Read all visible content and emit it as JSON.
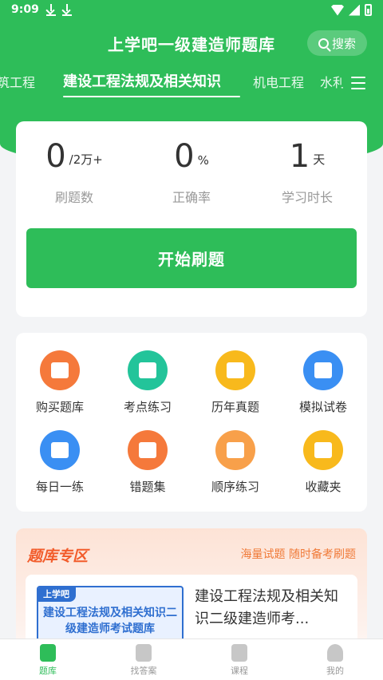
{
  "status_bar": {
    "time": "9:09"
  },
  "header": {
    "title": "上学吧一级建造师题库",
    "search_label": "搜索"
  },
  "tabs": [
    {
      "label": "筑工程"
    },
    {
      "label": "建设工程法规及相关知识"
    },
    {
      "label": "机电工程"
    },
    {
      "label": "水利"
    }
  ],
  "stats": [
    {
      "value": "0",
      "unit": "/2万+",
      "label": "刷题数"
    },
    {
      "value": "0",
      "unit": "%",
      "label": "正确率"
    },
    {
      "value": "1",
      "unit": "天",
      "label": "学习时长"
    }
  ],
  "start_button": "开始刷题",
  "features": [
    {
      "label": "购买题库",
      "icon": "cart-icon",
      "color": "#f5793b"
    },
    {
      "label": "考点练习",
      "icon": "star-board-icon",
      "color": "#23c49a"
    },
    {
      "label": "历年真题",
      "icon": "calendar-doc-icon",
      "color": "#f8b91c"
    },
    {
      "label": "模拟试卷",
      "icon": "chart-board-icon",
      "color": "#3a8ff3"
    },
    {
      "label": "每日一练",
      "icon": "calendar-check-icon",
      "color": "#3a8ff3"
    },
    {
      "label": "错题集",
      "icon": "wrong-doc-icon",
      "color": "#f5793b"
    },
    {
      "label": "顺序练习",
      "icon": "edit-doc-icon",
      "color": "#f8a04a"
    },
    {
      "label": "收藏夹",
      "icon": "star-icon",
      "color": "#f8b91c"
    }
  ],
  "zone": {
    "title": "题库专区",
    "subtitle": "海量试题 随时备考刷题",
    "book": {
      "cover_brand": "上学吧",
      "cover_text": "建设工程法规及相关知识二级建造师考试题库",
      "name": "建设工程法规及相关知识二级建造师考..."
    }
  },
  "bottom_nav": [
    {
      "label": "题库",
      "icon": "question-bank-icon"
    },
    {
      "label": "找答案",
      "icon": "find-answer-icon"
    },
    {
      "label": "课程",
      "icon": "course-play-icon"
    },
    {
      "label": "我的",
      "icon": "profile-icon"
    }
  ],
  "colors": {
    "primary": "#2ebd59",
    "zone_accent": "#f25c2b"
  }
}
